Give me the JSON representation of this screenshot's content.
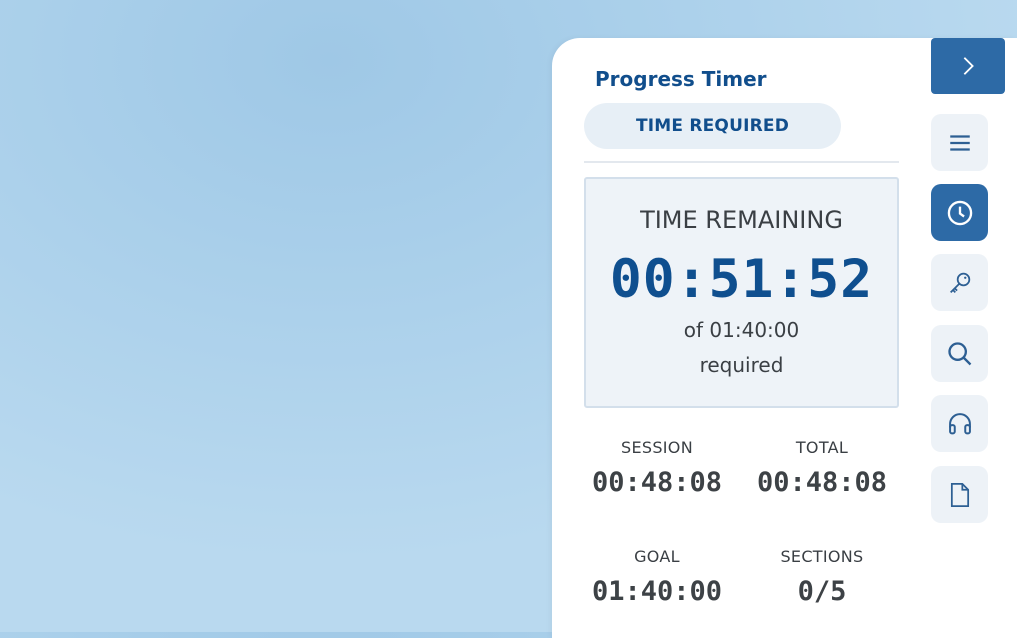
{
  "panel": {
    "title": "Progress Timer",
    "mode_pill": "TIME REQUIRED"
  },
  "remaining": {
    "label": "TIME REMAINING",
    "time": "00:51:52",
    "of_text": "of 01:40:00",
    "required_text": "required"
  },
  "stats": {
    "session": {
      "label": "SESSION",
      "value": "00:48:08"
    },
    "total": {
      "label": "TOTAL",
      "value": "00:48:08"
    },
    "goal": {
      "label": "GOAL",
      "value": "01:40:00"
    },
    "sections": {
      "label": "SECTIONS",
      "value": "0/5"
    }
  },
  "rail": {
    "items": [
      {
        "icon": "chevron-right-icon"
      },
      {
        "icon": "menu-icon"
      },
      {
        "icon": "clock-icon",
        "active": true
      },
      {
        "icon": "key-icon"
      },
      {
        "icon": "search-icon"
      },
      {
        "icon": "headphones-icon"
      },
      {
        "icon": "document-icon"
      }
    ]
  },
  "colors": {
    "accent": "#2d6aa6",
    "title_blue": "#114e8c",
    "timer_blue": "#0f4f8f"
  }
}
